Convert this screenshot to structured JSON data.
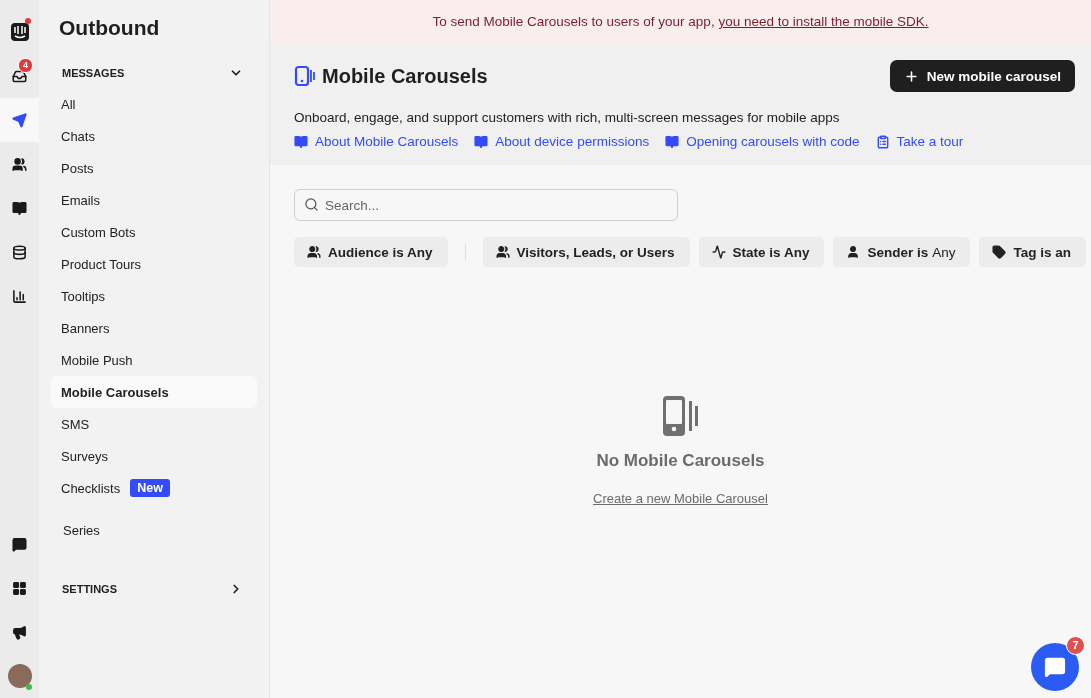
{
  "rail": {
    "items": [
      {
        "kind": "logo",
        "selected": false,
        "notification": true
      },
      {
        "kind": "inbox",
        "selected": false,
        "badge": "4"
      },
      {
        "kind": "outbound",
        "selected": true
      },
      {
        "kind": "contacts",
        "selected": false
      },
      {
        "kind": "articles",
        "selected": false
      },
      {
        "kind": "operator",
        "selected": false
      },
      {
        "kind": "reports",
        "selected": false
      }
    ],
    "bottom": [
      {
        "kind": "messenger",
        "selected": false
      },
      {
        "kind": "apps",
        "selected": false
      },
      {
        "kind": "news",
        "selected": false
      },
      {
        "kind": "avatar",
        "selected": false,
        "online": true
      }
    ]
  },
  "sidebar": {
    "title": "Outbound",
    "sections": [
      {
        "label": "MESSAGES",
        "expanded": true,
        "items": [
          {
            "label": "All",
            "selected": false
          },
          {
            "label": "Chats",
            "selected": false
          },
          {
            "label": "Posts",
            "selected": false
          },
          {
            "label": "Emails",
            "selected": false
          },
          {
            "label": "Custom Bots",
            "selected": false
          },
          {
            "label": "Product Tours",
            "selected": false
          },
          {
            "label": "Tooltips",
            "selected": false
          },
          {
            "label": "Banners",
            "selected": false
          },
          {
            "label": "Mobile Push",
            "selected": false
          },
          {
            "label": "Mobile Carousels",
            "selected": true
          },
          {
            "label": "SMS",
            "selected": false
          },
          {
            "label": "Surveys",
            "selected": false
          },
          {
            "label": "Checklists",
            "selected": false,
            "badge": "New"
          }
        ]
      }
    ],
    "series": {
      "label": "Series",
      "selected": false
    },
    "settings": {
      "label": "SETTINGS",
      "expanded": false
    }
  },
  "banner": {
    "text": "To send Mobile Carousels to users of your app, ",
    "link": "you need to install the mobile SDK."
  },
  "header": {
    "title": "Mobile Carousels",
    "button": "New mobile carousel",
    "description": "Onboard, engage, and support customers with rich, multi-screen messages for mobile apps",
    "links": [
      {
        "kind": "article",
        "label": "About Mobile Carousels"
      },
      {
        "kind": "article",
        "label": "About device permissions"
      },
      {
        "kind": "article",
        "label": "Opening carousels with code"
      },
      {
        "kind": "tour",
        "label": "Take a tour"
      }
    ]
  },
  "search": {
    "placeholder": "Search..."
  },
  "filters": [
    {
      "kind": "audience",
      "label": "Audience is Any"
    },
    {
      "kind": "people",
      "label": "Visitors, Leads, or Users"
    },
    {
      "kind": "state",
      "label": "State is Any"
    },
    {
      "kind": "sender",
      "label": "Sender is",
      "value": "Any"
    },
    {
      "kind": "tag",
      "label": "Tag is an"
    }
  ],
  "empty": {
    "title": "No Mobile Carousels",
    "link": "Create a new Mobile Carousel"
  },
  "messenger": {
    "badge": "7"
  }
}
